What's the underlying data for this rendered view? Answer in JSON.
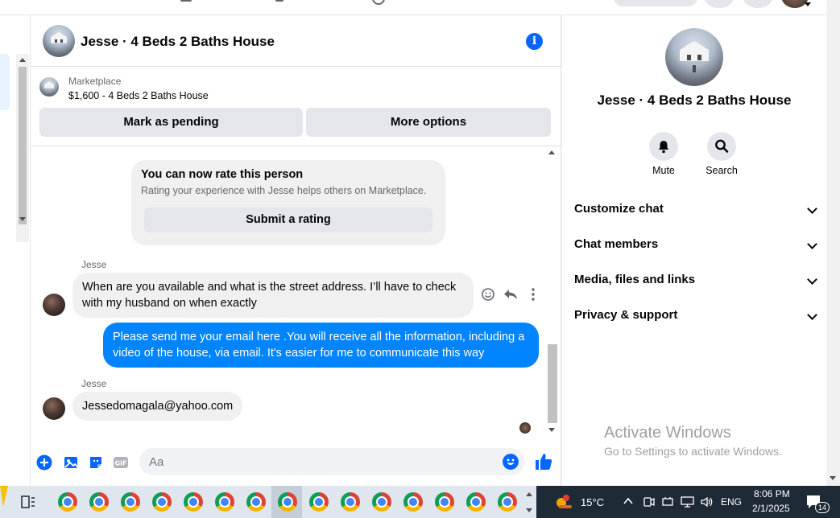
{
  "chat": {
    "title": "Jesse · 4 Beds 2 Baths House",
    "marketplace_label": "Marketplace",
    "listing": "$1,600 - 4 Beds 2 Baths House",
    "mark_pending": "Mark as pending",
    "more_options": "More options",
    "rate_title": "You can now rate this person",
    "rate_sub": "Rating your experience with Jesse helps others on Marketplace.",
    "rate_button": "Submit a rating",
    "messages": [
      {
        "sender": "Jesse",
        "text": "When are you available and what is the street address. I’ll have to check with my husband on when exactly",
        "direction": "in"
      },
      {
        "sender": "",
        "text": "Please send me your email here .You will receive all the information, including a video of the house, via email. It's easier for me to communicate this way",
        "direction": "out"
      },
      {
        "sender": "Jesse",
        "text": "Jessedomagala@yahoo.com",
        "direction": "in"
      }
    ],
    "composer_placeholder": "Aa"
  },
  "side": {
    "title": "Jesse · 4 Beds 2 Baths House",
    "actions": [
      "Mute",
      "Search"
    ],
    "sections": [
      "Customize chat",
      "Chat members",
      "Media, files and links",
      "Privacy & support"
    ],
    "watermark_title": "Activate Windows",
    "watermark_sub": "Go to Settings to activate Windows."
  },
  "taskbar": {
    "weather": "15°C",
    "lang": "ENG",
    "time": "8:06 PM",
    "date": "2/1/2025",
    "notifications": "14"
  },
  "colors": {
    "accent": "#0866ff",
    "outgoing_bubble": "#0084ff"
  }
}
